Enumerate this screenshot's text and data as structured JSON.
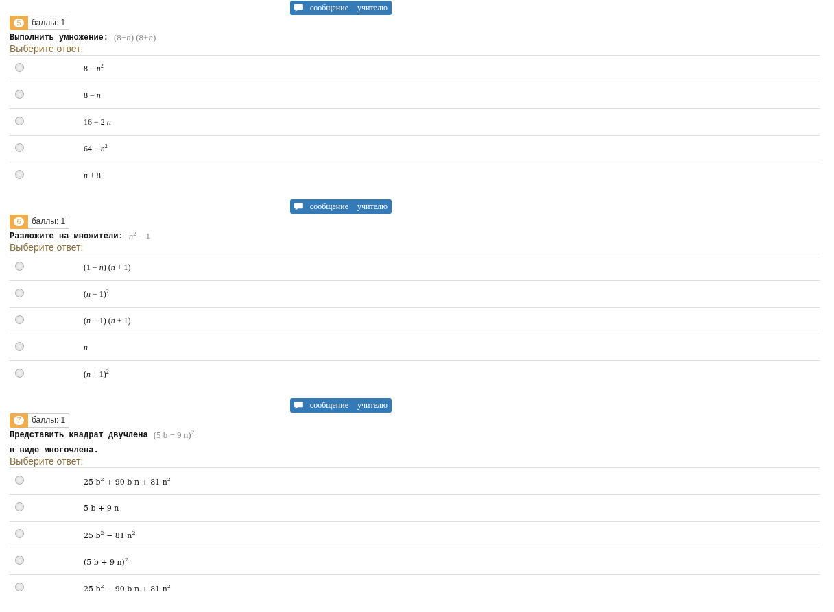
{
  "questions": [
    {
      "message_button": "сообщение учителю",
      "number": "5",
      "points": "баллы: 1",
      "text": "Выполнить умножение:",
      "expression": "(8−*n*) (8+*n*)",
      "answer_label": "Выберите ответ:",
      "kind": "formula",
      "options": [
        {
          "label": "8 − *n*$^{2}$",
          "selected": false
        },
        {
          "label": "8 − *n*",
          "selected": false
        },
        {
          "label": "16 − 2 *n*",
          "selected": false
        },
        {
          "label": "64 − *n*$^{2}$",
          "selected": false
        },
        {
          "label": "*n* + 8",
          "selected": false
        }
      ]
    },
    {
      "message_button": "сообщение учителю",
      "number": "6",
      "points": "баллы: 1",
      "text": "Разложите на множители:",
      "expression": "*n*$^{2}$ − 1",
      "answer_label": "Выберите ответ:",
      "kind": "formula",
      "options": [
        {
          "label": "(1 − *n*) (*n* + 1)",
          "selected": false
        },
        {
          "label": "(*n* − 1)$^{2}$",
          "selected": false
        },
        {
          "label": "(*n* − 1) (*n* + 1)",
          "selected": false
        },
        {
          "label": "*n*",
          "selected": false
        },
        {
          "label": "(*n* + 1)$^{2}$",
          "selected": false
        }
      ]
    },
    {
      "message_button": "сообщение учителю",
      "number": "7",
      "points": "баллы: 1",
      "text": "Представить квадрат двучлена",
      "expression": "(5 b − 9 n)$^{2}$",
      "continuation": "в виде многочлена.",
      "answer_label": "Выберите ответ:",
      "kind": "plain",
      "options": [
        {
          "label": "25 b$^{2}$ + 90 b n + 81 n$^{2}$",
          "selected": false
        },
        {
          "label": "5 b + 9 n",
          "selected": false
        },
        {
          "label": "25 b$^{2}$ − 81 n$^{2}$",
          "selected": false
        },
        {
          "label": "(5 b + 9 n)$^{2}$",
          "selected": false
        },
        {
          "label": "25 b$^{2}$ − 90 b n + 81 n$^{2}$",
          "selected": false
        }
      ]
    }
  ]
}
